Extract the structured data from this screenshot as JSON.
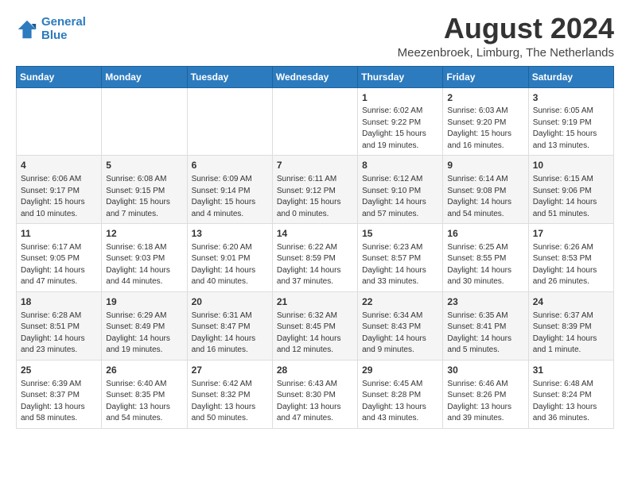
{
  "logo": {
    "line1": "General",
    "line2": "Blue"
  },
  "title": "August 2024",
  "subtitle": "Meezenbroek, Limburg, The Netherlands",
  "weekdays": [
    "Sunday",
    "Monday",
    "Tuesday",
    "Wednesday",
    "Thursday",
    "Friday",
    "Saturday"
  ],
  "weeks": [
    [
      {
        "day": "",
        "info": ""
      },
      {
        "day": "",
        "info": ""
      },
      {
        "day": "",
        "info": ""
      },
      {
        "day": "",
        "info": ""
      },
      {
        "day": "1",
        "info": "Sunrise: 6:02 AM\nSunset: 9:22 PM\nDaylight: 15 hours\nand 19 minutes."
      },
      {
        "day": "2",
        "info": "Sunrise: 6:03 AM\nSunset: 9:20 PM\nDaylight: 15 hours\nand 16 minutes."
      },
      {
        "day": "3",
        "info": "Sunrise: 6:05 AM\nSunset: 9:19 PM\nDaylight: 15 hours\nand 13 minutes."
      }
    ],
    [
      {
        "day": "4",
        "info": "Sunrise: 6:06 AM\nSunset: 9:17 PM\nDaylight: 15 hours\nand 10 minutes."
      },
      {
        "day": "5",
        "info": "Sunrise: 6:08 AM\nSunset: 9:15 PM\nDaylight: 15 hours\nand 7 minutes."
      },
      {
        "day": "6",
        "info": "Sunrise: 6:09 AM\nSunset: 9:14 PM\nDaylight: 15 hours\nand 4 minutes."
      },
      {
        "day": "7",
        "info": "Sunrise: 6:11 AM\nSunset: 9:12 PM\nDaylight: 15 hours\nand 0 minutes."
      },
      {
        "day": "8",
        "info": "Sunrise: 6:12 AM\nSunset: 9:10 PM\nDaylight: 14 hours\nand 57 minutes."
      },
      {
        "day": "9",
        "info": "Sunrise: 6:14 AM\nSunset: 9:08 PM\nDaylight: 14 hours\nand 54 minutes."
      },
      {
        "day": "10",
        "info": "Sunrise: 6:15 AM\nSunset: 9:06 PM\nDaylight: 14 hours\nand 51 minutes."
      }
    ],
    [
      {
        "day": "11",
        "info": "Sunrise: 6:17 AM\nSunset: 9:05 PM\nDaylight: 14 hours\nand 47 minutes."
      },
      {
        "day": "12",
        "info": "Sunrise: 6:18 AM\nSunset: 9:03 PM\nDaylight: 14 hours\nand 44 minutes."
      },
      {
        "day": "13",
        "info": "Sunrise: 6:20 AM\nSunset: 9:01 PM\nDaylight: 14 hours\nand 40 minutes."
      },
      {
        "day": "14",
        "info": "Sunrise: 6:22 AM\nSunset: 8:59 PM\nDaylight: 14 hours\nand 37 minutes."
      },
      {
        "day": "15",
        "info": "Sunrise: 6:23 AM\nSunset: 8:57 PM\nDaylight: 14 hours\nand 33 minutes."
      },
      {
        "day": "16",
        "info": "Sunrise: 6:25 AM\nSunset: 8:55 PM\nDaylight: 14 hours\nand 30 minutes."
      },
      {
        "day": "17",
        "info": "Sunrise: 6:26 AM\nSunset: 8:53 PM\nDaylight: 14 hours\nand 26 minutes."
      }
    ],
    [
      {
        "day": "18",
        "info": "Sunrise: 6:28 AM\nSunset: 8:51 PM\nDaylight: 14 hours\nand 23 minutes."
      },
      {
        "day": "19",
        "info": "Sunrise: 6:29 AM\nSunset: 8:49 PM\nDaylight: 14 hours\nand 19 minutes."
      },
      {
        "day": "20",
        "info": "Sunrise: 6:31 AM\nSunset: 8:47 PM\nDaylight: 14 hours\nand 16 minutes."
      },
      {
        "day": "21",
        "info": "Sunrise: 6:32 AM\nSunset: 8:45 PM\nDaylight: 14 hours\nand 12 minutes."
      },
      {
        "day": "22",
        "info": "Sunrise: 6:34 AM\nSunset: 8:43 PM\nDaylight: 14 hours\nand 9 minutes."
      },
      {
        "day": "23",
        "info": "Sunrise: 6:35 AM\nSunset: 8:41 PM\nDaylight: 14 hours\nand 5 minutes."
      },
      {
        "day": "24",
        "info": "Sunrise: 6:37 AM\nSunset: 8:39 PM\nDaylight: 14 hours\nand 1 minute."
      }
    ],
    [
      {
        "day": "25",
        "info": "Sunrise: 6:39 AM\nSunset: 8:37 PM\nDaylight: 13 hours\nand 58 minutes."
      },
      {
        "day": "26",
        "info": "Sunrise: 6:40 AM\nSunset: 8:35 PM\nDaylight: 13 hours\nand 54 minutes."
      },
      {
        "day": "27",
        "info": "Sunrise: 6:42 AM\nSunset: 8:32 PM\nDaylight: 13 hours\nand 50 minutes."
      },
      {
        "day": "28",
        "info": "Sunrise: 6:43 AM\nSunset: 8:30 PM\nDaylight: 13 hours\nand 47 minutes."
      },
      {
        "day": "29",
        "info": "Sunrise: 6:45 AM\nSunset: 8:28 PM\nDaylight: 13 hours\nand 43 minutes."
      },
      {
        "day": "30",
        "info": "Sunrise: 6:46 AM\nSunset: 8:26 PM\nDaylight: 13 hours\nand 39 minutes."
      },
      {
        "day": "31",
        "info": "Sunrise: 6:48 AM\nSunset: 8:24 PM\nDaylight: 13 hours\nand 36 minutes."
      }
    ]
  ]
}
